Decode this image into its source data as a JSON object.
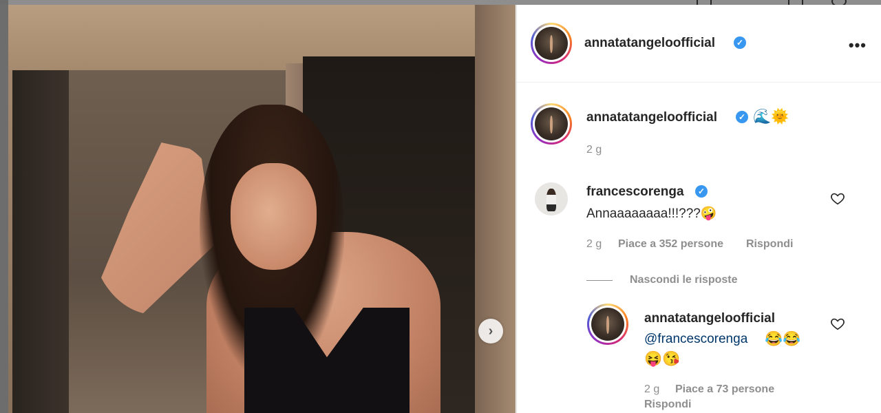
{
  "post": {
    "author": "annatatangeloofficial",
    "author_verified": true,
    "more_icon": "more-horizontal-icon"
  },
  "caption": {
    "username": "annatatangeloofficial",
    "emojis": "🌊🌞",
    "time": "2 g"
  },
  "comments": [
    {
      "username": "francescorenga",
      "text": "Annaaaaaaaa!!!???🤪",
      "time": "2 g",
      "likes": "Piace a 352 persone",
      "reply_label": "Rispondi",
      "hide_replies": "Nascondi le risposte",
      "replies": [
        {
          "username": "annatatangeloofficial",
          "mention": "@francescorenga",
          "text_line1_emojis": "😂😂",
          "text_line2_emojis": "😝😘",
          "time": "2 g",
          "likes": "Piace a 73 persone",
          "reply_label": "Rispondi"
        }
      ]
    }
  ],
  "colors": {
    "verified": "#3897f0",
    "muted": "#8e8e8e",
    "text": "#262626",
    "mention": "#00376b"
  },
  "icons": {
    "next": "chevron-right-icon",
    "like": "heart-icon",
    "verified": "verified-badge-icon"
  }
}
